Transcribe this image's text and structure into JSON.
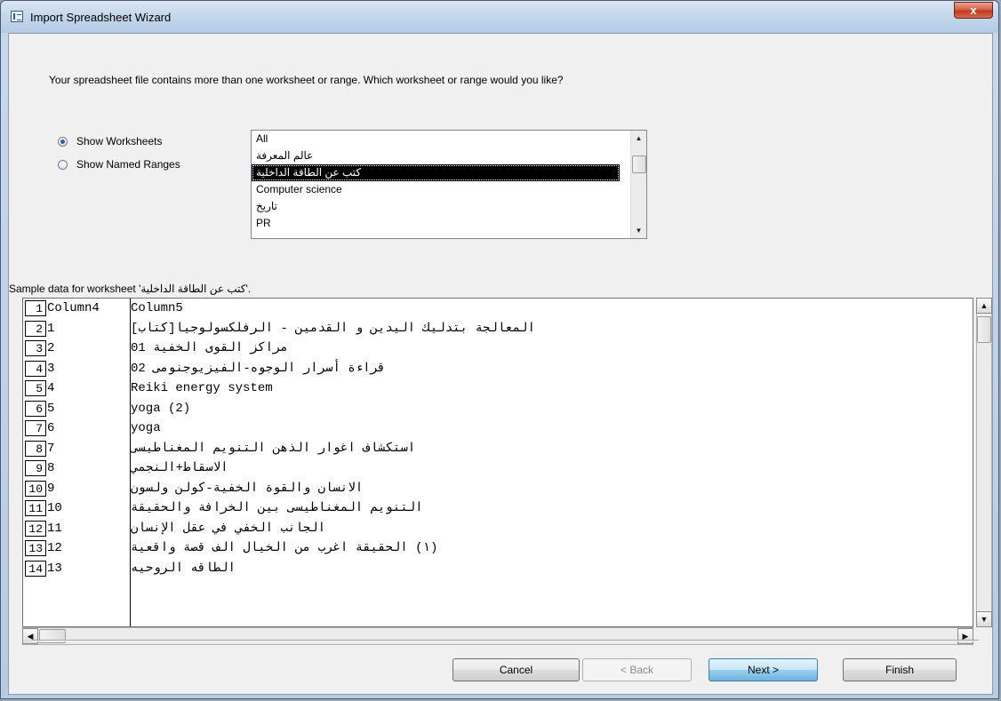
{
  "window": {
    "title": "Import Spreadsheet Wizard",
    "close_glyph": "x"
  },
  "prompt": "Your spreadsheet file contains more than one worksheet or range. Which worksheet or range would you like?",
  "view_options": {
    "show_worksheets": "Show Worksheets",
    "show_named_ranges": "Show Named Ranges",
    "selected": "show_worksheets"
  },
  "worksheets": [
    "All",
    "عالم المعرفة",
    "كتب عن الطاقة الداخلية",
    "Computer science",
    "تاريخ",
    "PR"
  ],
  "selected_worksheet_index": 2,
  "sample": {
    "label": "Sample data for worksheet 'كتب عن الطاقة الداخلية'.",
    "rows": [
      [
        "1",
        "Column4",
        "Column5"
      ],
      [
        "2",
        "1",
        "المعالجة بتدليك اليدين و القدمين - الرفلكسولوجيا[كتاب]"
      ],
      [
        "3",
        "2",
        "مراكز القوى الخفية 01"
      ],
      [
        "4",
        "3",
        "قراءة أسرار الوجوه-الفيزيوجنومى 02"
      ],
      [
        "5",
        "4",
        "Reiki energy system"
      ],
      [
        "6",
        "5",
        "yoga (2)"
      ],
      [
        "7",
        "6",
        "yoga"
      ],
      [
        "8",
        "7",
        "استكشاف اغوار الذهن التنويم المغناطيسى"
      ],
      [
        "9",
        "8",
        "الاسقاط+النجمي"
      ],
      [
        "10",
        "9",
        "الانسان والقوة الخفية-كولن ولسون"
      ],
      [
        "11",
        "10",
        "التنويم المغناطيسى بين الخرافة والحقيقة"
      ],
      [
        "12",
        "11",
        "الجانب الخفي في عقل الإنسان"
      ],
      [
        "13",
        "12",
        "(١) الحقيقة اغرب من الخيال الف قصة واقعية"
      ],
      [
        "14",
        "13",
        "الطاقه الروحيه"
      ]
    ]
  },
  "buttons": {
    "cancel": "Cancel",
    "back": "< Back",
    "next": "Next >",
    "finish": "Finish"
  },
  "icons": {
    "scroll_up": "scroll-up-arrow-icon",
    "scroll_down": "scroll-down-arrow-icon",
    "scroll_left": "scroll-left-arrow-icon",
    "scroll_right": "scroll-right-arrow-icon",
    "title_icon": "spreadsheet-icon"
  },
  "colors": {
    "selection": "#000000",
    "primary_button": "#98d1ef",
    "close_button": "#c2391f"
  }
}
